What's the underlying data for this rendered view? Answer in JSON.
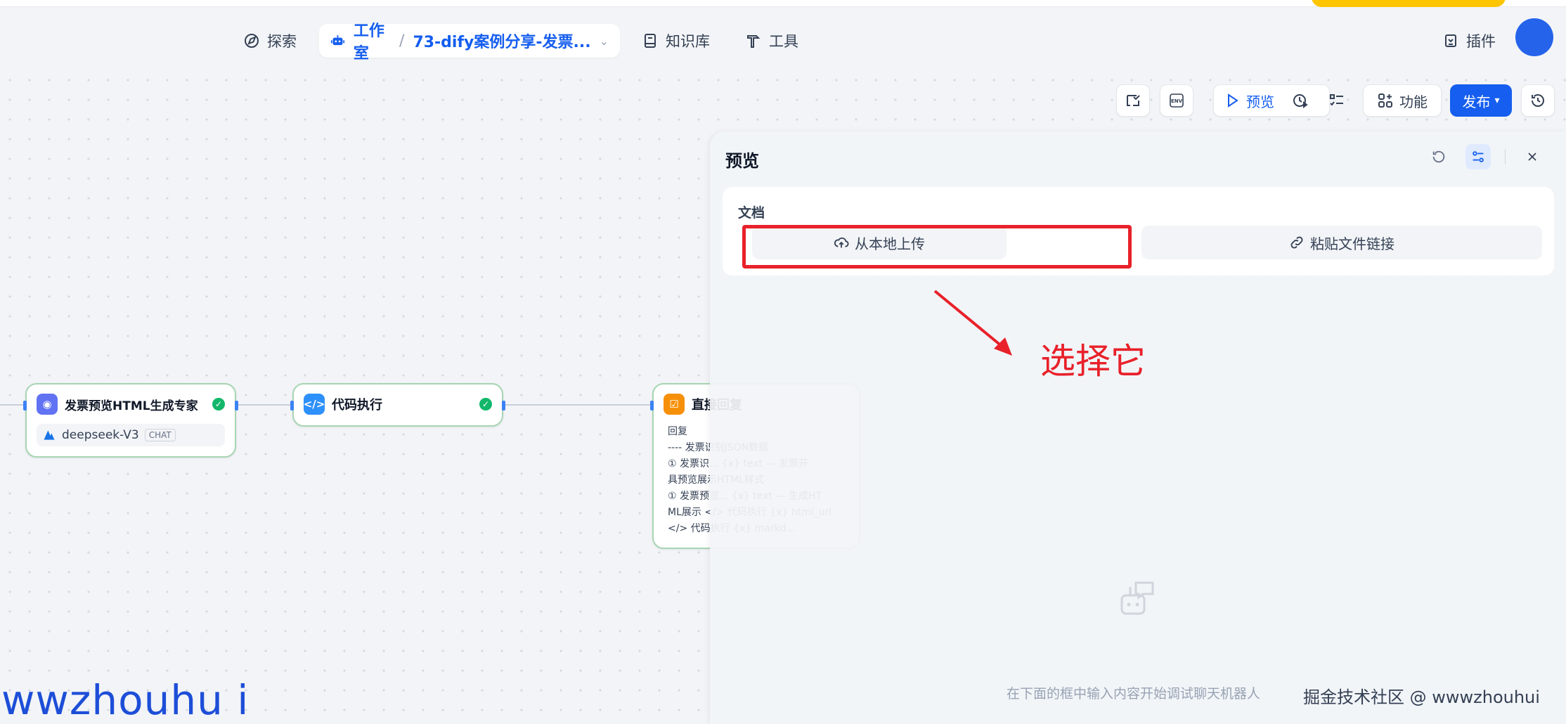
{
  "nav": {
    "explore": "探索",
    "studio": "工作室",
    "app_name": "73-dify案例分享-发票...",
    "knowledge": "知识库",
    "tools": "工具",
    "plugins": "插件"
  },
  "toolbar": {
    "env": "ENV",
    "preview": "预览",
    "features": "功能",
    "publish": "发布"
  },
  "nodes": [
    {
      "title": "发票预览HTML生成专家",
      "model": "deepseek-V3",
      "model_tag": "CHAT",
      "icon": "llm-icon"
    },
    {
      "title": "代码执行",
      "icon": "code-icon"
    },
    {
      "title": "直接回复",
      "label": "回复",
      "body_lines": [
        "---- 发票识别JSON数据",
        "① 发票识...  {x} text  —  发票开",
        "具预览展示HTML样式",
        "① 发票预览...  {x} text  —  生成HT",
        "ML展示  </> 代码执行  {x} html_url",
        "</> 代码执行  {x} markd..."
      ],
      "icon": "reply-icon"
    }
  ],
  "preview_panel": {
    "title": "预览",
    "doc_label": "文档",
    "upload_local": "从本地上传",
    "paste_link": "粘贴文件链接",
    "empty_hint": "在下面的框中输入内容开始调试聊天机器人"
  },
  "annotation": {
    "text": "选择它",
    "color": "#e8212a"
  },
  "watermarks": {
    "left": "wwzhouhu i",
    "right": "掘金技术社区 @ wwwzhouhui"
  },
  "colors": {
    "accent": "#155eef",
    "success": "#12b76a",
    "annotation_red": "#e8212a"
  }
}
